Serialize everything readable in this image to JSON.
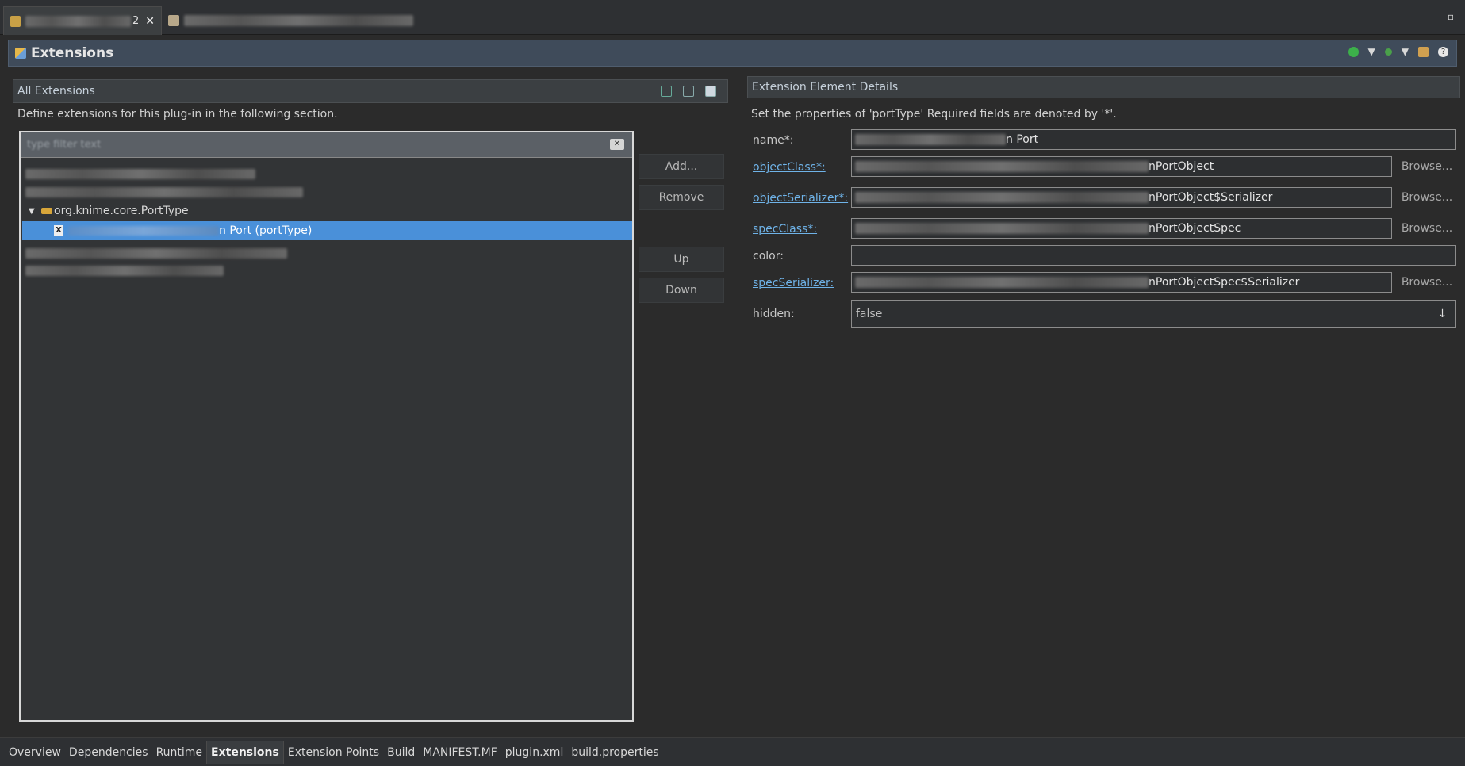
{
  "editor_tabs": [
    {
      "label_suffix": "2",
      "close": "✕"
    },
    {
      "label_suffix": ""
    }
  ],
  "window_controls": {
    "minimize": "–",
    "restore": "▫"
  },
  "form": {
    "title": "Extensions"
  },
  "all_extensions": {
    "title": "All Extensions",
    "description": "Define extensions for this plug-in in the following section.",
    "filter_placeholder": "type filter text",
    "tree": [
      {
        "label": "",
        "blurred": true
      },
      {
        "label": "",
        "blurred": true
      },
      {
        "label": "org.knime.core.PortType",
        "expanded": true
      },
      {
        "label": "n Port (portType)",
        "selected": true
      },
      {
        "label": "",
        "blurred": true
      },
      {
        "label": "",
        "blurred": true
      }
    ]
  },
  "buttons": {
    "add": "Add...",
    "remove": "Remove",
    "up": "Up",
    "down": "Down"
  },
  "details": {
    "title": "Extension Element Details",
    "description": "Set the properties of 'portType' Required fields are denoted by '*'.",
    "fields": [
      {
        "label": "name*:",
        "value": "n Port",
        "link": false
      },
      {
        "label": "objectClass*:",
        "value": "nPortObject",
        "link": true,
        "browse": "Browse..."
      },
      {
        "label": "objectSerializer*:",
        "value": "nPortObject$Serializer",
        "link": true,
        "browse": "Browse..."
      },
      {
        "label": "specClass*:",
        "value": "nPortObjectSpec",
        "link": true,
        "browse": "Browse..."
      },
      {
        "label": "color:",
        "value": "",
        "link": false
      },
      {
        "label": "specSerializer:",
        "value": "nPortObjectSpec$Serializer",
        "link": true,
        "browse": "Browse..."
      },
      {
        "label": "hidden:",
        "value": "false",
        "link": false
      }
    ]
  },
  "page_tabs": [
    "Overview",
    "Dependencies",
    "Runtime",
    "Extensions",
    "Extension Points",
    "Build",
    "MANIFEST.MF",
    "plugin.xml",
    "build.properties"
  ],
  "active_page_tab": "Extensions"
}
